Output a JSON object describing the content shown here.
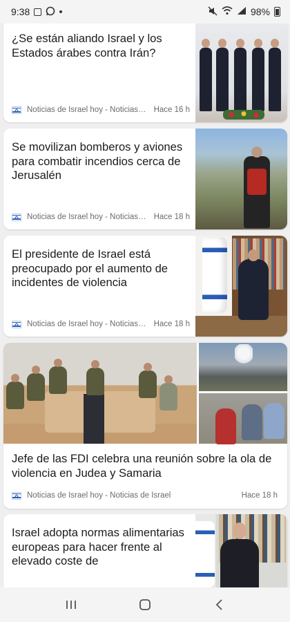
{
  "status_bar": {
    "time": "9:38",
    "battery": "98%"
  },
  "articles": [
    {
      "headline": "¿Se están aliando Israel y los Estados árabes contra Irán?",
      "source": "Noticias de Israel hoy - Noticias de Israel",
      "time": "Hace 16 h"
    },
    {
      "headline": "Se movilizan bomberos y aviones para combatir incendios cerca de Jerusalén",
      "source": "Noticias de Israel hoy - Noticias de Israel",
      "time": "Hace 18 h"
    },
    {
      "headline": "El presidente de Israel está preocupado por el aumento de incidentes de violencia",
      "source": "Noticias de Israel hoy - Noticias de Israel",
      "time": "Hace 18 h"
    },
    {
      "headline": "Jefe de las FDI celebra una reunión sobre la ola de violencia en Judea y Samaria",
      "source": "Noticias de Israel hoy - Noticias de Israel",
      "time": "Hace 18 h"
    },
    {
      "headline": "Israel adopta normas alimentarias europeas para hacer frente al elevado coste de"
    }
  ],
  "navigation": {
    "recents": "|||",
    "back": "<"
  }
}
